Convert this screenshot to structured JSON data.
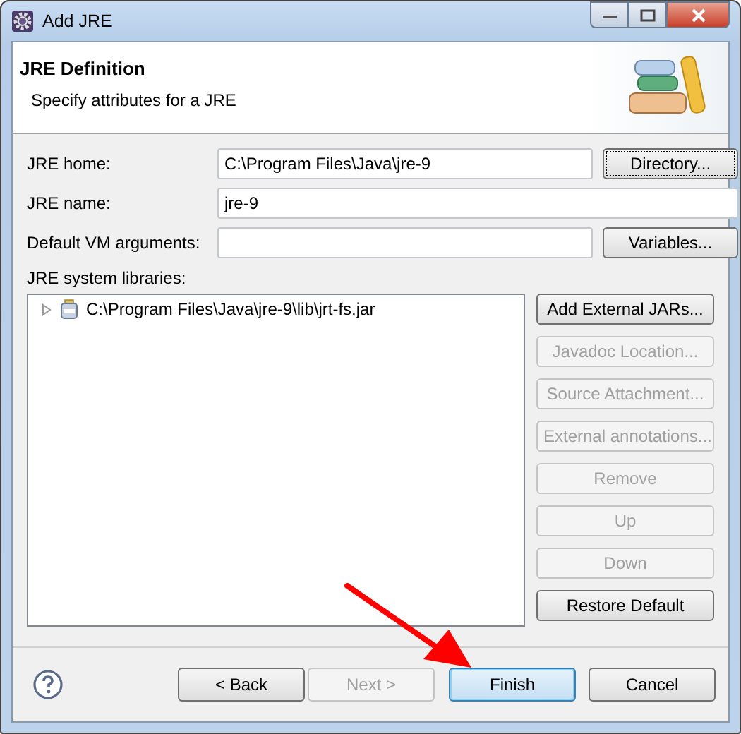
{
  "window": {
    "title": "Add JRE"
  },
  "header": {
    "title": "JRE Definition",
    "description": "Specify attributes for a JRE"
  },
  "fields": [
    {
      "label": "JRE home:",
      "value": "C:\\Program Files\\Java\\jre-9",
      "button": {
        "label": "Directory...",
        "focused": true
      }
    },
    {
      "label": "JRE name:",
      "value": "jre-9"
    },
    {
      "label": "Default VM arguments:",
      "button": {
        "label": "Variables...",
        "focused": false
      }
    }
  ],
  "libraries": {
    "label": "JRE system libraries:",
    "items": [
      {
        "label": "C:\\Program Files\\Java\\jre-9\\lib\\jrt-fs.jar",
        "expanded": false
      }
    ],
    "buttons": [
      {
        "label": "Add External JARs...",
        "disabled": false
      },
      {
        "label": "Javadoc Location...",
        "disabled": true
      },
      {
        "label": "Source Attachment...",
        "disabled": true
      },
      {
        "label": "External annotations...",
        "disabled": true
      },
      {
        "label": "Remove",
        "disabled": true
      },
      {
        "label": "Up",
        "disabled": true
      },
      {
        "label": "Down",
        "disabled": true
      },
      {
        "label": "Restore Default",
        "disabled": false
      }
    ]
  },
  "dialog_buttons": [
    {
      "label": "< Back",
      "disabled": false,
      "default": false
    },
    {
      "label": "Next >",
      "disabled": true,
      "default": false
    },
    {
      "label": "Finish",
      "disabled": false,
      "default": true
    },
    {
      "label": "Cancel",
      "disabled": false,
      "default": false
    }
  ]
}
